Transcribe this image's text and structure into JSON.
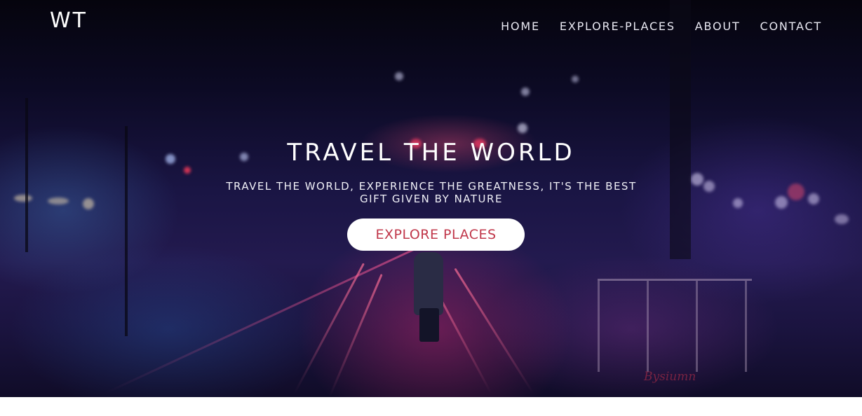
{
  "header": {
    "logo": "WT",
    "nav": [
      "HOME",
      "EXPLORE-PLACES",
      "ABOUT",
      "CONTACT"
    ]
  },
  "hero": {
    "title": "TRAVEL THE WORLD",
    "subtitle": "TRAVEL THE WORLD, EXPERIENCE THE GREATNESS, IT'S THE BEST GIFT GIVEN BY NATURE",
    "cta_label": "EXPLORE PLACES",
    "watermark": "Bysiumn"
  },
  "colors": {
    "cta_text": "#c0374a",
    "cta_bg": "#ffffff",
    "hero_dark": "#0c0a24",
    "page_bg": "#ffffff"
  }
}
